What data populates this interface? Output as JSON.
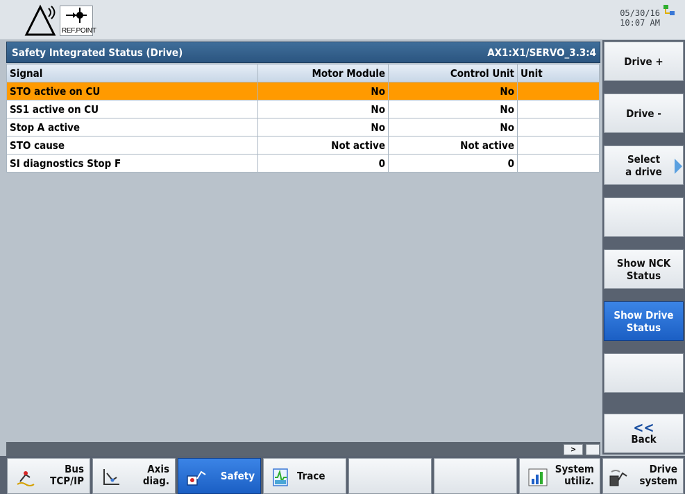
{
  "header": {
    "ref_point_label": "REF.POINT",
    "date": "05/30/16",
    "time": "10:07 AM"
  },
  "title_bar": {
    "title": "Safety Integrated Status (Drive)",
    "axis": "AX1:X1/SERVO_3.3:4"
  },
  "table": {
    "columns": [
      "Signal",
      "Motor Module",
      "Control Unit",
      "Unit"
    ],
    "rows": [
      {
        "signal": "STO active on CU",
        "motor_module": "No",
        "control_unit": "No",
        "unit": "",
        "selected": true
      },
      {
        "signal": "SS1 active on CU",
        "motor_module": "No",
        "control_unit": "No",
        "unit": ""
      },
      {
        "signal": "Stop A active",
        "motor_module": "No",
        "control_unit": "No",
        "unit": ""
      },
      {
        "signal": "STO cause",
        "motor_module": "Not active",
        "control_unit": "Not active",
        "unit": ""
      },
      {
        "signal": "SI diagnostics Stop F",
        "motor_module": "0",
        "control_unit": "0",
        "unit": ""
      }
    ]
  },
  "scroll_right_label": ">",
  "vertical_softkeys": [
    {
      "line1": "Drive +",
      "line2": ""
    },
    {
      "line1": "Drive -",
      "line2": ""
    },
    {
      "line1": "Select",
      "line2": "a drive"
    },
    {
      "line1": "",
      "line2": ""
    },
    {
      "line1": "Show NCK",
      "line2": "Status"
    },
    {
      "line1": "Show Drive",
      "line2": "Status",
      "active": true
    },
    {
      "line1": "",
      "line2": ""
    },
    {
      "chevrons": "<<",
      "line1": "Back"
    }
  ],
  "horizontal_softkeys": [
    {
      "line1": "Bus",
      "line2": "TCP/IP",
      "icon": "bus-network-icon"
    },
    {
      "line1": "Axis",
      "line2": "diag.",
      "icon": "axis-diagnosis-icon"
    },
    {
      "line1": "Safety",
      "icon": "safety-icon",
      "active": true
    },
    {
      "line1": "Trace",
      "icon": "trace-icon"
    },
    {
      "line1": ""
    },
    {
      "line1": ""
    },
    {
      "line1": "System",
      "line2": "utiliz.",
      "icon": "bar-chart-icon"
    },
    {
      "line1": "Drive",
      "line2": "system",
      "icon": "drive-system-icon"
    }
  ],
  "colors": {
    "title_bar": "#2f5f8c",
    "selected_row": "#ff9a00",
    "active_softkey": "#2a6fd6"
  }
}
